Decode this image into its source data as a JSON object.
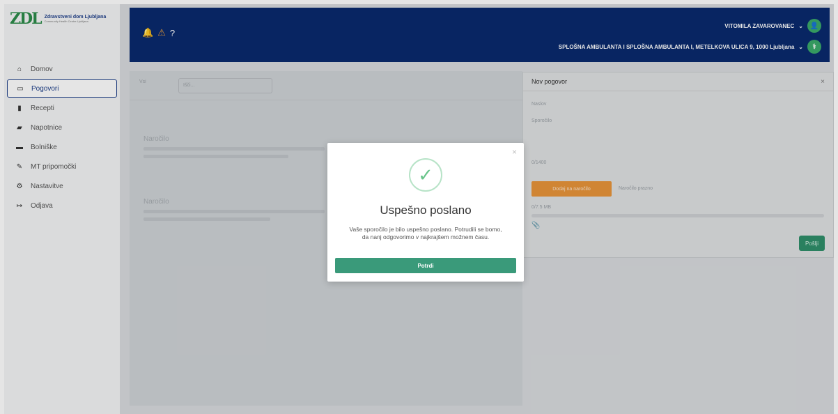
{
  "logo": {
    "mark": "ZDL",
    "title": "Zdravstveni dom Ljubljana",
    "subtitle": "Community Health Centre Ljubljana"
  },
  "sidebar": {
    "items": [
      {
        "label": "Domov",
        "icon": "home-icon"
      },
      {
        "label": "Pogovori",
        "icon": "chat-icon",
        "active": true
      },
      {
        "label": "Recepti",
        "icon": "prescription-icon"
      },
      {
        "label": "Napotnice",
        "icon": "referral-icon"
      },
      {
        "label": "Bolniške",
        "icon": "bed-icon"
      },
      {
        "label": "MT pripomočki",
        "icon": "tool-icon"
      },
      {
        "label": "Nastavitve",
        "icon": "settings-icon"
      },
      {
        "label": "Odjava",
        "icon": "logout-icon"
      }
    ]
  },
  "header": {
    "user": "VITOMILA ZAVAROVANEC",
    "ambulanta": "SPLOŠNA AMBULANTA I SPLOŠNA AMBULANTA I, METELKOVA ULICA 9, 1000 Ljubljana",
    "colors": {
      "bg": "#0a2a6e",
      "accent": "#3aaa6a"
    }
  },
  "list": {
    "filter_label": "Vsi",
    "search_placeholder": "Išči...",
    "rows": [
      {
        "title": "Naročilo"
      },
      {
        "title": "Naročilo"
      }
    ]
  },
  "panel": {
    "title": "Nov pogovor",
    "subject_label": "Naslov",
    "message_label": "Sporočilo",
    "counter": "0/1400",
    "add_button": "Dodaj na naročilo",
    "order_status": "Naročilo prazno",
    "size_label": "0/7.5 MB",
    "send_button": "Pošlji"
  },
  "modal": {
    "title": "Uspešno poslano",
    "text": "Vaše sporočilo je bilo uspešno poslano. Potrudili se bomo, da nanj odgovorimo v najkrajšem možnem času.",
    "button": "Potrdi",
    "colors": {
      "button": "#3a9a7a",
      "check": "#69c48a"
    }
  }
}
